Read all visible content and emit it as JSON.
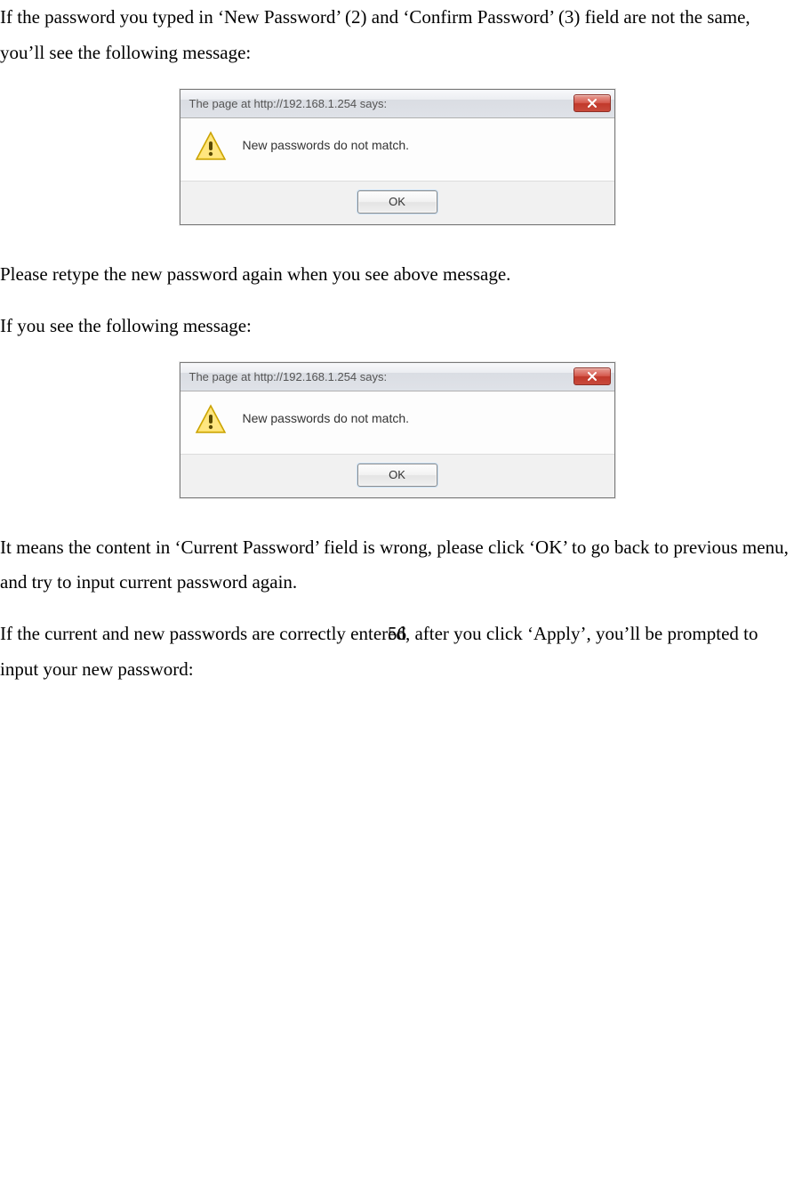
{
  "paragraphs": {
    "p1": "If the password you typed in ‘New Password’ (2) and ‘Confirm Password’ (3) field are not the same, you’ll see the following message:",
    "p2": "Please retype the new password again when you see above message.",
    "p3": "If you see the following message:",
    "p4": "It means the content in ‘Current Password’ field is wrong, please click ‘OK’ to go back to previous menu, and try to input current password again.",
    "p5": "If the current and new passwords are correctly entered, after you click ‘Apply’, you’ll be prompted to input your new password:"
  },
  "dialog1": {
    "title": "The page at http://192.168.1.254 says:",
    "message": "New passwords do not match.",
    "ok_label": "OK"
  },
  "dialog2": {
    "title": "The page at http://192.168.1.254 says:",
    "message": "New passwords do not match.",
    "ok_label": "OK"
  },
  "page_number": "56"
}
